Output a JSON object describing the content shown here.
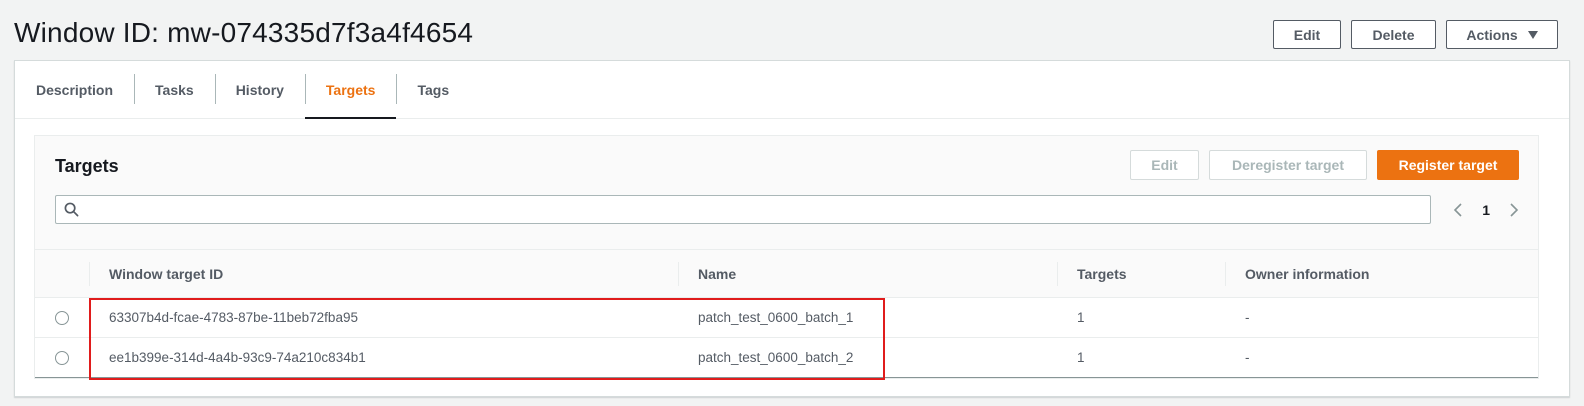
{
  "header": {
    "title": "Window ID: mw-074335d7f3a4f4654",
    "edit_label": "Edit",
    "delete_label": "Delete",
    "actions_label": "Actions"
  },
  "tabs": [
    {
      "label": "Description",
      "active": false
    },
    {
      "label": "Tasks",
      "active": false
    },
    {
      "label": "History",
      "active": false
    },
    {
      "label": "Targets",
      "active": true
    },
    {
      "label": "Tags",
      "active": false
    }
  ],
  "targets": {
    "title": "Targets",
    "edit_label": "Edit",
    "deregister_label": "Deregister target",
    "register_label": "Register target",
    "search": {
      "placeholder": "",
      "value": ""
    },
    "page": "1",
    "columns": [
      "Window target ID",
      "Name",
      "Targets",
      "Owner information"
    ],
    "rows": [
      {
        "id": "63307b4d-fcae-4783-87be-11beb72fba95",
        "name": "patch_test_0600_batch_1",
        "targets": "1",
        "owner": "-"
      },
      {
        "id": "ee1b399e-314d-4a4b-93c9-74a210c834b1",
        "name": "patch_test_0600_batch_2",
        "targets": "1",
        "owner": "-"
      }
    ]
  },
  "colors": {
    "accent": "#ec7211",
    "highlight": "#e01c1c"
  }
}
